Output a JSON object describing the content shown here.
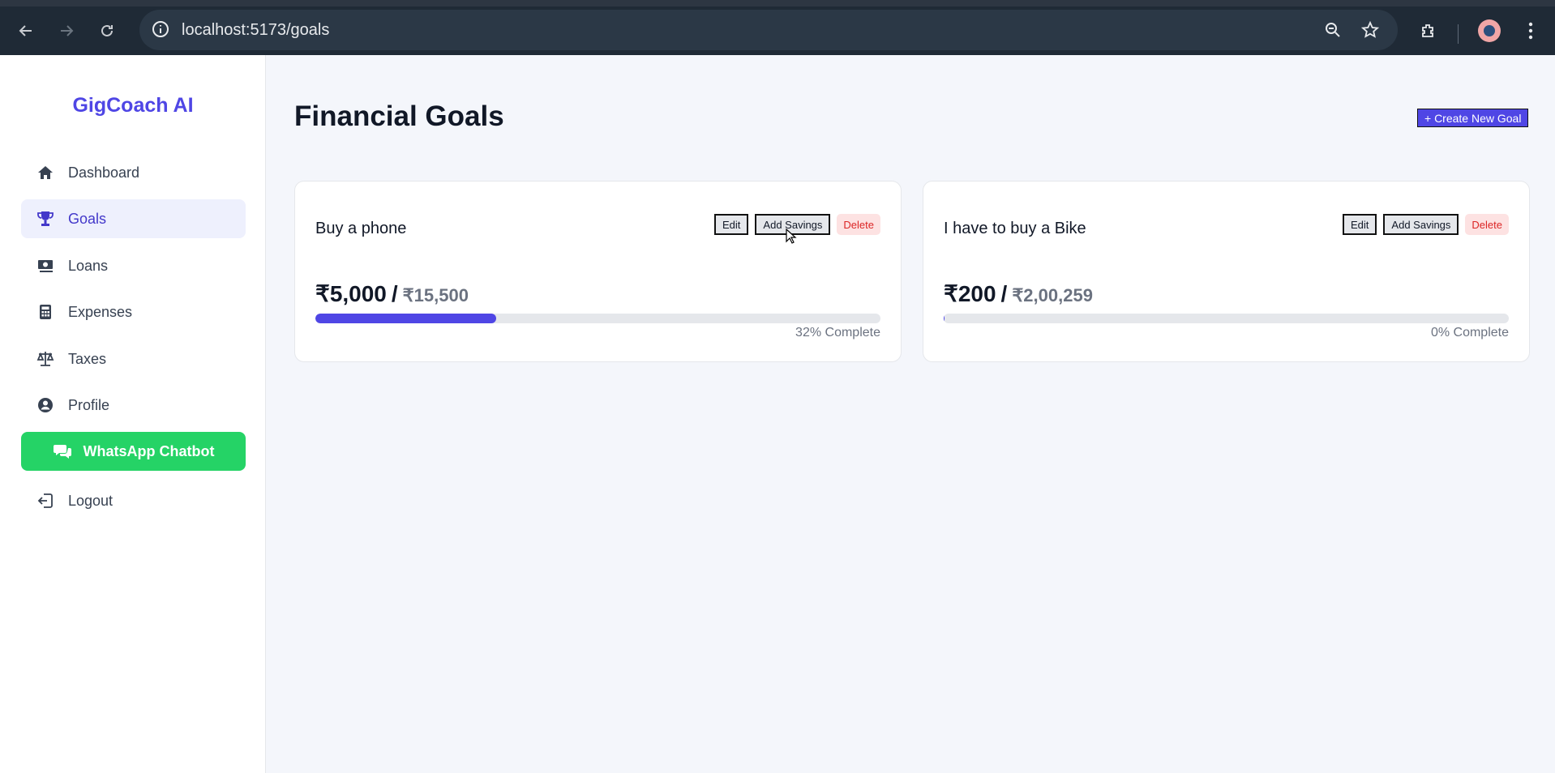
{
  "browser": {
    "url": "localhost:5173/goals"
  },
  "sidebar": {
    "brand": "GigCoach AI",
    "items": [
      {
        "label": "Dashboard",
        "icon": "home-icon"
      },
      {
        "label": "Goals",
        "icon": "trophy-icon",
        "active": true
      },
      {
        "label": "Loans",
        "icon": "money-icon"
      },
      {
        "label": "Expenses",
        "icon": "calculator-icon"
      },
      {
        "label": "Taxes",
        "icon": "scale-icon"
      },
      {
        "label": "Profile",
        "icon": "user-circle-icon"
      },
      {
        "label": "WhatsApp Chatbot",
        "icon": "chat-icon"
      },
      {
        "label": "Logout",
        "icon": "logout-icon"
      }
    ]
  },
  "main": {
    "title": "Financial Goals",
    "create_label": "+ Create New Goal",
    "goals": [
      {
        "name": "Buy a phone",
        "saved": "₹5,000",
        "target": "₹15,500",
        "progress": 0.32,
        "percent_label": "32% Complete",
        "edit_label": "Edit",
        "add_label": "Add Savings",
        "delete_label": "Delete"
      },
      {
        "name": "I have to buy a Bike",
        "saved": "₹200",
        "target": "₹2,00,259",
        "progress": 0.001,
        "percent_label": "0% Complete",
        "edit_label": "Edit",
        "add_label": "Add Savings",
        "delete_label": "Delete"
      }
    ]
  },
  "colors": {
    "accent": "#4f46e5",
    "whatsapp": "#25d366",
    "delete": "#dc2626"
  }
}
